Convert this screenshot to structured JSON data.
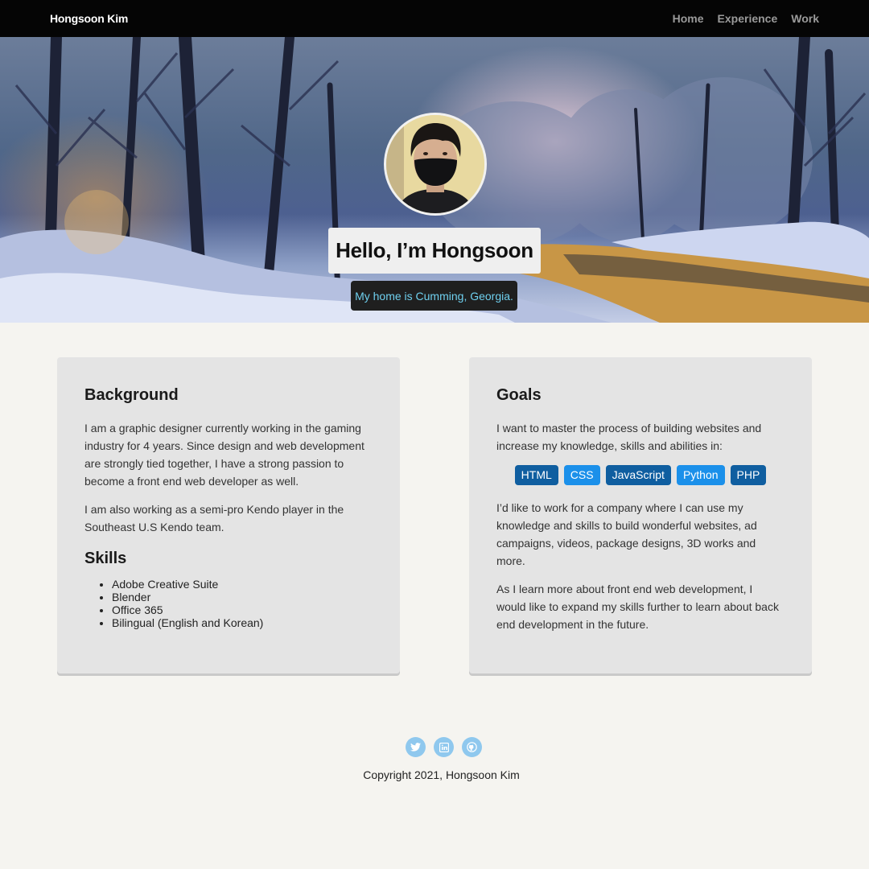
{
  "nav": {
    "brand": "Hongsoon Kim",
    "links": [
      "Home",
      "Experience",
      "Work"
    ]
  },
  "hero": {
    "title": "Hello, I’m Hongsoon",
    "subtitle": "My home is Cumming, Georgia."
  },
  "background": {
    "heading": "Background",
    "paragraphs": [
      "I am a graphic designer currently working in the gaming industry for 4 years. Since design and web development are strongly tied together, I have a strong passion to become a front end web developer as well.",
      "I am also working as a semi-pro Kendo player in the Southeast U.S Kendo team."
    ],
    "skills_heading": "Skills",
    "skills": [
      "Adobe Creative Suite",
      "Blender",
      "Office 365",
      "Bilingual (English and Korean)"
    ]
  },
  "goals": {
    "heading": "Goals",
    "intro": "I want to master the process of building websites and increase my knowledge, skills and abilities in:",
    "badges": [
      "HTML",
      "CSS",
      "JavaScript",
      "Python",
      "PHP"
    ],
    "paragraphs": [
      "I’d like to work for a company where I can use my knowledge and skills to build wonderful websites, ad campaigns, videos, package designs, 3D works and more.",
      "As I learn more about front end web development, I would like to expand my skills further to learn about back end development in the future."
    ]
  },
  "footer": {
    "social": [
      "twitter-icon",
      "linkedin-icon",
      "github-icon"
    ],
    "copyright": "Copyright 2021, Hongsoon Kim"
  },
  "colors": {
    "navbar": "#050505",
    "badge_dark": "#0f5ea0",
    "badge_light": "#1b90ea",
    "subtitle_text": "#6fd0ef",
    "social_icon_bg": "#8fc8ee",
    "page_bg": "#f5f4f0",
    "card_bg": "#e4e4e4"
  }
}
